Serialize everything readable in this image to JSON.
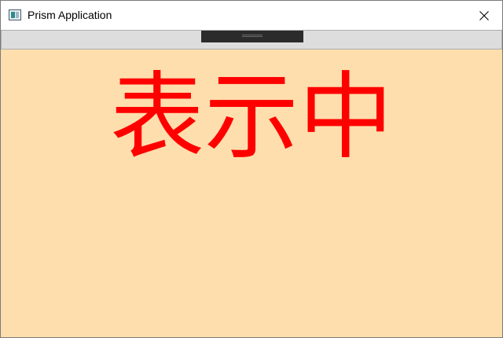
{
  "window": {
    "title": "Prism Application",
    "icon": "app-window-icon",
    "close_icon": "close-icon"
  },
  "toolbar": {
    "next_label": "Next"
  },
  "content": {
    "display_text": "表示中",
    "background_color": "#FFDEAD",
    "text_color": "#FF0000"
  }
}
